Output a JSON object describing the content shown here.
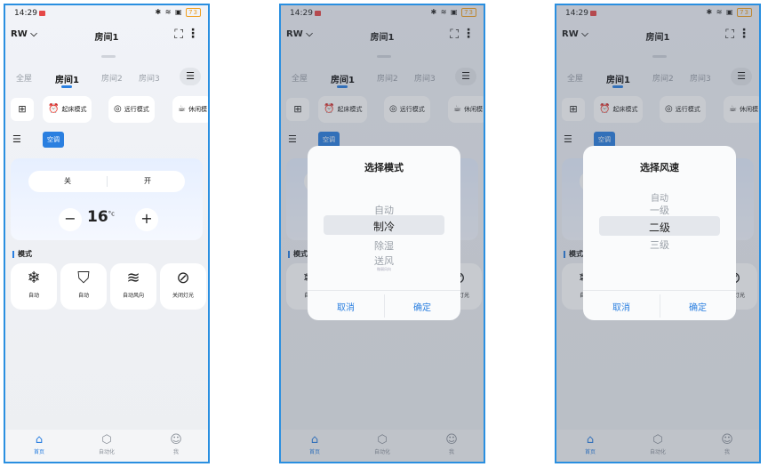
{
  "status": {
    "time": "14:29",
    "icons": "✱ ≋ ▣",
    "battery": "73"
  },
  "topbar": {
    "home": "RW ⌵",
    "title": "房间1"
  },
  "tabs": {
    "whole": "全屋",
    "room1": "房间1",
    "room2": "房间2",
    "room3": "房间3"
  },
  "scenes": {
    "wake": "起床模式",
    "away": "远行模式",
    "rest": "休闲模"
  },
  "filter_chip": "空调",
  "ac": {
    "off": "关",
    "on": "开",
    "temperature": "16",
    "unit": "°c"
  },
  "modes": {
    "header": "模式",
    "items": [
      {
        "label": "自动",
        "icon": "snowflake-icon"
      },
      {
        "label": "自动",
        "icon": "shield-icon"
      },
      {
        "label": "自动风向",
        "icon": "wind-icon"
      },
      {
        "label": "关闭灯光",
        "icon": "light-off-icon"
      }
    ]
  },
  "nav": {
    "home": "首页",
    "automation": "自动化",
    "me": "我"
  },
  "dialog_mode": {
    "title": "选择模式",
    "options": [
      "自动",
      "制冷",
      "除湿",
      "送风"
    ],
    "selected": "制冷",
    "sub_label": "微弱风向",
    "cancel": "取消",
    "confirm": "确定"
  },
  "dialog_fan": {
    "title": "选择风速",
    "options": [
      "自动",
      "一级",
      "二级",
      "三级"
    ],
    "selected": "二级",
    "cancel": "取消",
    "confirm": "确定"
  },
  "colors": {
    "accent": "#2a7fe0",
    "frame": "#2a8fe0"
  }
}
